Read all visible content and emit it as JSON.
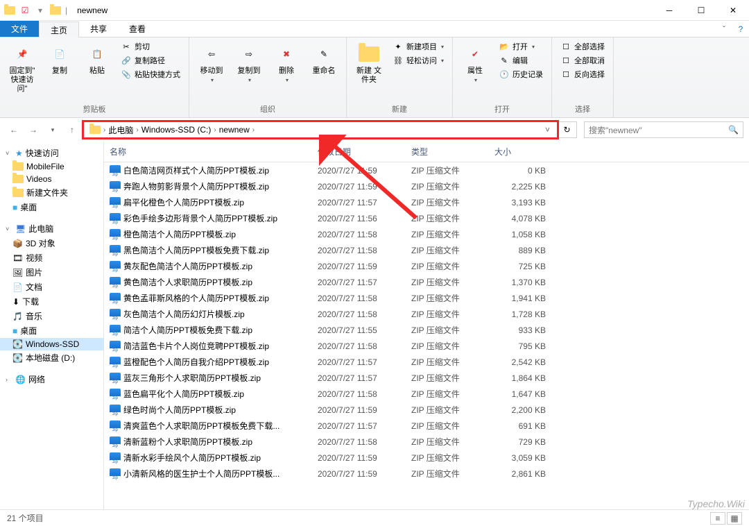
{
  "window": {
    "title": "newnew"
  },
  "tabs": {
    "file": "文件",
    "home": "主页",
    "share": "共享",
    "view": "查看"
  },
  "ribbon": {
    "clipboard": {
      "label": "剪贴板",
      "pin": "固定到\"\n快速访问\"",
      "copy": "复制",
      "paste": "粘贴",
      "cut": "剪切",
      "copypath": "复制路径",
      "pasteshortcut": "粘贴快捷方式"
    },
    "organize": {
      "label": "组织",
      "moveto": "移动到",
      "copyto": "复制到",
      "delete": "删除",
      "rename": "重命名"
    },
    "new": {
      "label": "新建",
      "newfolder": "新建\n文件夹",
      "newitem": "新建项目",
      "easyaccess": "轻松访问"
    },
    "open": {
      "label": "打开",
      "properties": "属性",
      "open_btn": "打开",
      "edit": "编辑",
      "history": "历史记录"
    },
    "select": {
      "label": "选择",
      "selectall": "全部选择",
      "selectnone": "全部取消",
      "invert": "反向选择"
    }
  },
  "breadcrumb": {
    "items": [
      "此电脑",
      "Windows-SSD (C:)",
      "newnew"
    ]
  },
  "search": {
    "placeholder": "搜索\"newnew\""
  },
  "sidebar": {
    "quick": {
      "label": "快速访问",
      "items": [
        "MobileFile",
        "Videos",
        "新建文件夹",
        "桌面"
      ]
    },
    "thispc": {
      "label": "此电脑",
      "items": [
        "3D 对象",
        "视频",
        "图片",
        "文档",
        "下载",
        "音乐",
        "桌面",
        "Windows-SSD",
        "本地磁盘 (D:)"
      ]
    },
    "network": {
      "label": "网络"
    }
  },
  "columns": {
    "name": "名称",
    "date": "修改日期",
    "type": "类型",
    "size": "大小"
  },
  "files": [
    {
      "name": "白色简洁网页样式个人简历PPT模板.zip",
      "date": "2020/7/27 11:59",
      "type": "ZIP 压缩文件",
      "size": "0 KB"
    },
    {
      "name": "奔跑人物剪影背景个人简历PPT模板.zip",
      "date": "2020/7/27 11:59",
      "type": "ZIP 压缩文件",
      "size": "2,225 KB"
    },
    {
      "name": "扁平化橙色个人简历PPT模板.zip",
      "date": "2020/7/27 11:57",
      "type": "ZIP 压缩文件",
      "size": "3,193 KB"
    },
    {
      "name": "彩色手绘多边形背景个人简历PPT模板.zip",
      "date": "2020/7/27 11:56",
      "type": "ZIP 压缩文件",
      "size": "4,078 KB"
    },
    {
      "name": "橙色简洁个人简历PPT模板.zip",
      "date": "2020/7/27 11:58",
      "type": "ZIP 压缩文件",
      "size": "1,058 KB"
    },
    {
      "name": "黑色简洁个人简历PPT模板免费下载.zip",
      "date": "2020/7/27 11:58",
      "type": "ZIP 压缩文件",
      "size": "889 KB"
    },
    {
      "name": "黄灰配色简洁个人简历PPT模板.zip",
      "date": "2020/7/27 11:59",
      "type": "ZIP 压缩文件",
      "size": "725 KB"
    },
    {
      "name": "黄色简洁个人求职简历PPT模板.zip",
      "date": "2020/7/27 11:57",
      "type": "ZIP 压缩文件",
      "size": "1,370 KB"
    },
    {
      "name": "黄色孟菲斯风格的个人简历PPT模板.zip",
      "date": "2020/7/27 11:58",
      "type": "ZIP 压缩文件",
      "size": "1,941 KB"
    },
    {
      "name": "灰色简洁个人简历幻灯片模板.zip",
      "date": "2020/7/27 11:58",
      "type": "ZIP 压缩文件",
      "size": "1,728 KB"
    },
    {
      "name": "简洁个人简历PPT模板免费下载.zip",
      "date": "2020/7/27 11:55",
      "type": "ZIP 压缩文件",
      "size": "933 KB"
    },
    {
      "name": "简洁蓝色卡片个人岗位竞聘PPT模板.zip",
      "date": "2020/7/27 11:58",
      "type": "ZIP 压缩文件",
      "size": "795 KB"
    },
    {
      "name": "蓝橙配色个人简历自我介绍PPT模板.zip",
      "date": "2020/7/27 11:57",
      "type": "ZIP 压缩文件",
      "size": "2,542 KB"
    },
    {
      "name": "蓝灰三角形个人求职简历PPT模板.zip",
      "date": "2020/7/27 11:57",
      "type": "ZIP 压缩文件",
      "size": "1,864 KB"
    },
    {
      "name": "蓝色扁平化个人简历PPT模板.zip",
      "date": "2020/7/27 11:58",
      "type": "ZIP 压缩文件",
      "size": "1,647 KB"
    },
    {
      "name": "绿色时尚个人简历PPT模板.zip",
      "date": "2020/7/27 11:59",
      "type": "ZIP 压缩文件",
      "size": "2,200 KB"
    },
    {
      "name": "清爽蓝色个人求职简历PPT模板免费下载...",
      "date": "2020/7/27 11:57",
      "type": "ZIP 压缩文件",
      "size": "691 KB"
    },
    {
      "name": "清新蓝粉个人求职简历PPT模板.zip",
      "date": "2020/7/27 11:58",
      "type": "ZIP 压缩文件",
      "size": "729 KB"
    },
    {
      "name": "清新水彩手绘风个人简历PPT模板.zip",
      "date": "2020/7/27 11:59",
      "type": "ZIP 压缩文件",
      "size": "3,059 KB"
    },
    {
      "name": "小清新风格的医生护士个人简历PPT模板...",
      "date": "2020/7/27 11:59",
      "type": "ZIP 压缩文件",
      "size": "2,861 KB"
    }
  ],
  "status": {
    "count": "21 个项目"
  },
  "watermark": "Typecho.Wiki"
}
